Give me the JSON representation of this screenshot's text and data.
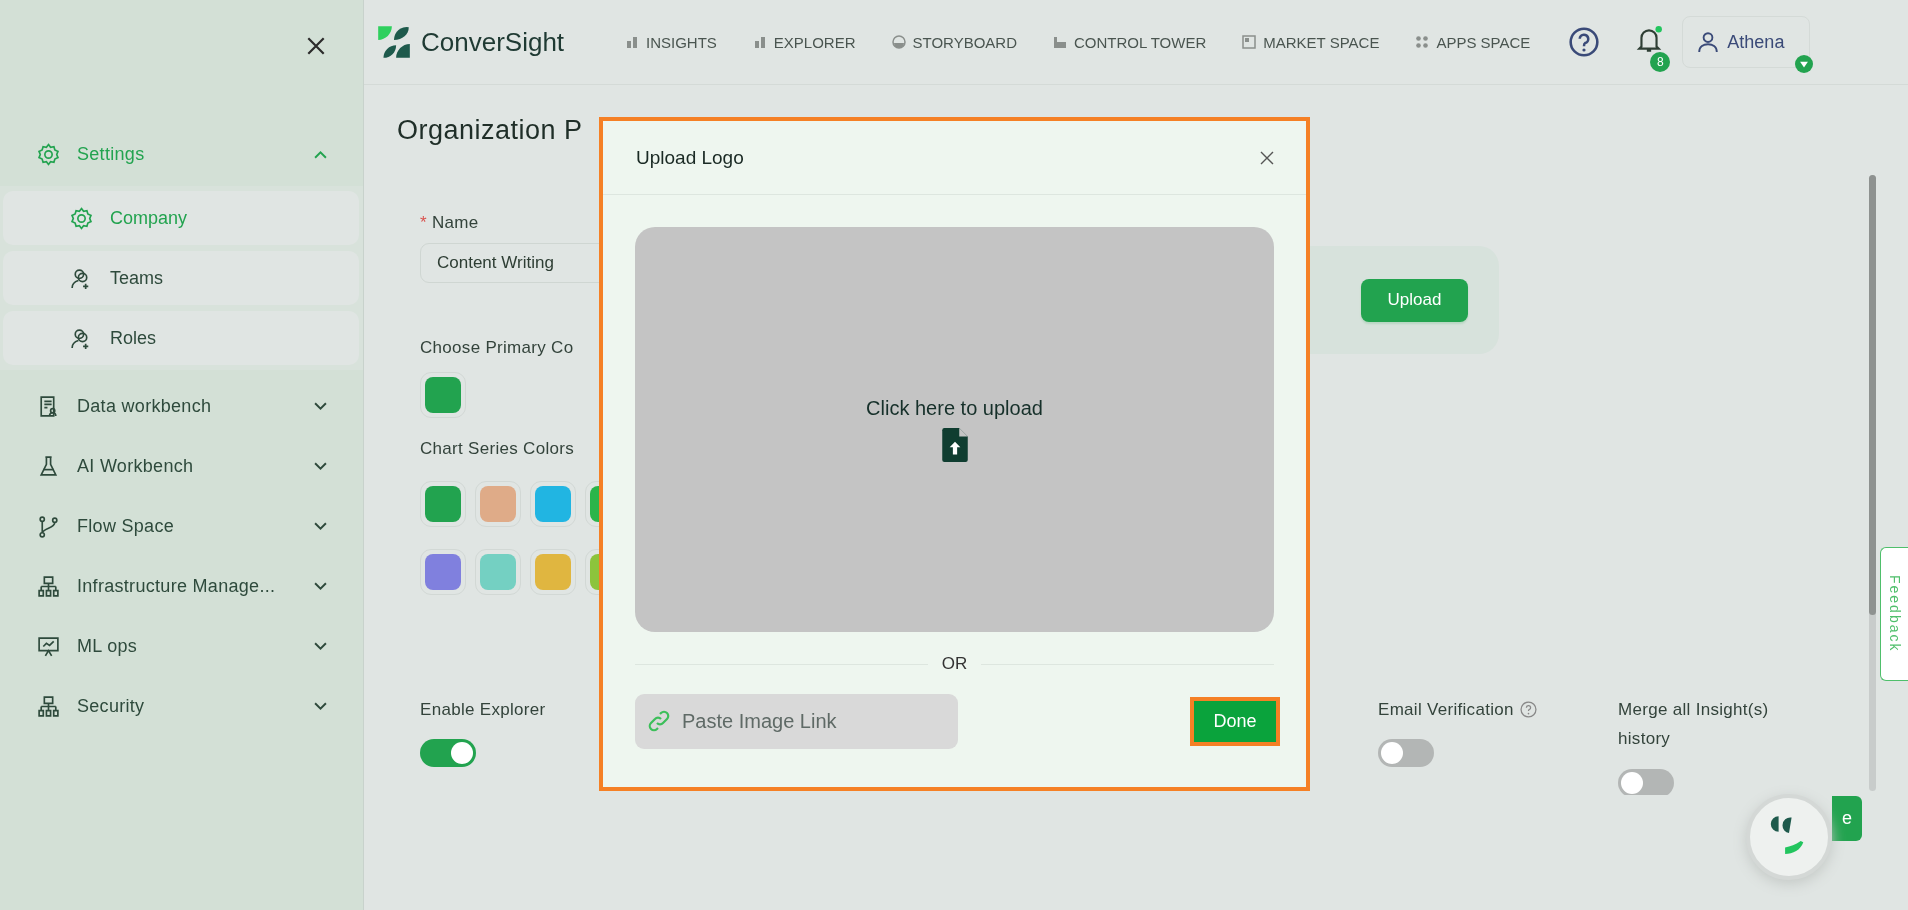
{
  "sidebar": {
    "items": [
      {
        "label": "Settings",
        "expanded": true,
        "children": [
          {
            "label": "Company",
            "selected": true
          },
          {
            "label": "Teams",
            "selected": false
          },
          {
            "label": "Roles",
            "selected": false
          }
        ]
      },
      {
        "label": "Data workbench",
        "expanded": false
      },
      {
        "label": "AI Workbench",
        "expanded": false
      },
      {
        "label": "Flow Space",
        "expanded": false
      },
      {
        "label": "Infrastructure Manage...",
        "expanded": false
      },
      {
        "label": "ML ops",
        "expanded": false
      },
      {
        "label": "Security",
        "expanded": false
      }
    ]
  },
  "topbar": {
    "logo": "ConverSight",
    "nav": [
      "INSIGHTS",
      "EXPLORER",
      "STORYBOARD",
      "CONTROL TOWER",
      "MARKET SPACE",
      "APPS SPACE"
    ],
    "notifications": "8",
    "user": "Athena"
  },
  "page": {
    "title": "Organization P",
    "name_field": {
      "required_mark": "*",
      "label": "Name",
      "value": "Content Writing"
    },
    "primary_color": {
      "label": "Choose Primary Co",
      "color": "#22a34f"
    },
    "chart_series": {
      "label": "Chart Series Colors",
      "rows": [
        [
          {
            "color": "#22a34f"
          },
          {
            "color": "#dfab88"
          },
          {
            "color": "#21b5e2"
          },
          {
            "color": "#2bb54a"
          }
        ],
        [
          {
            "color": "#8080de"
          },
          {
            "color": "#74d0c2"
          },
          {
            "color": "#e0b640"
          },
          {
            "color": "#8cc43c"
          }
        ]
      ]
    },
    "upload_button": "Upload",
    "toggles": [
      {
        "label": "Enable Explorer",
        "on": true,
        "help": false
      },
      {
        "label": "Email Verification",
        "on": false,
        "help": true
      },
      {
        "label": "Merge all Insight(s) history",
        "on": false,
        "help": false
      }
    ],
    "save_button": "e"
  },
  "feedback": "Feedback",
  "modal": {
    "title": "Upload Logo",
    "dropzone": "Click here to upload",
    "or": "OR",
    "link_placeholder": "Paste Image Link",
    "done": "Done"
  }
}
